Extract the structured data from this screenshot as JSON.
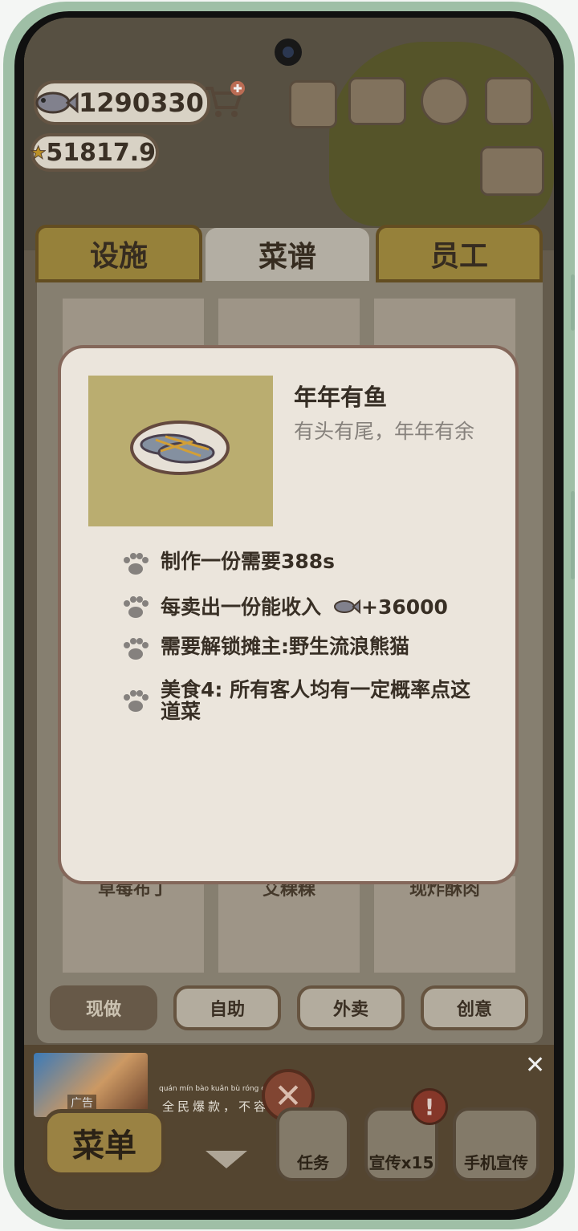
{
  "hud": {
    "fish_count": "1290330",
    "star_count": "51817.9"
  },
  "tabs": [
    {
      "label": "设施"
    },
    {
      "label": "菜谱"
    },
    {
      "label": "员工"
    }
  ],
  "recipe_grid_bottom": [
    {
      "label": "草莓布丁"
    },
    {
      "label": "艾粿粿"
    },
    {
      "label": "现炸酥肉"
    }
  ],
  "filters": [
    {
      "label": "现做"
    },
    {
      "label": "自助"
    },
    {
      "label": "外卖"
    },
    {
      "label": "创意"
    }
  ],
  "modal": {
    "title": "年年有鱼",
    "subtitle": "有头有尾，年年有余",
    "info": [
      {
        "text": "制作一份需要388s"
      },
      {
        "text": "每卖出一份能收入",
        "value": "+36000"
      },
      {
        "text": "需要解锁摊主:野生流浪熊猫"
      },
      {
        "text": "美食4: 所有客人均有一定概率点这道菜"
      }
    ]
  },
  "ad": {
    "tag": "广告",
    "text": "全民爆款，不容错过！",
    "pinyin": "quán mín bào kuǎn   bù róng cuò guò"
  },
  "bottom_bar": {
    "menu": "菜单",
    "task": "任务",
    "promote": "宣传x15",
    "phone_promote": "手机宣传"
  },
  "colors": {
    "modal_bg": "#faf4ea",
    "modal_border": "#8d6e60",
    "tab_active": "#bfb9ae",
    "tab_inactive": "#a08a3e"
  }
}
